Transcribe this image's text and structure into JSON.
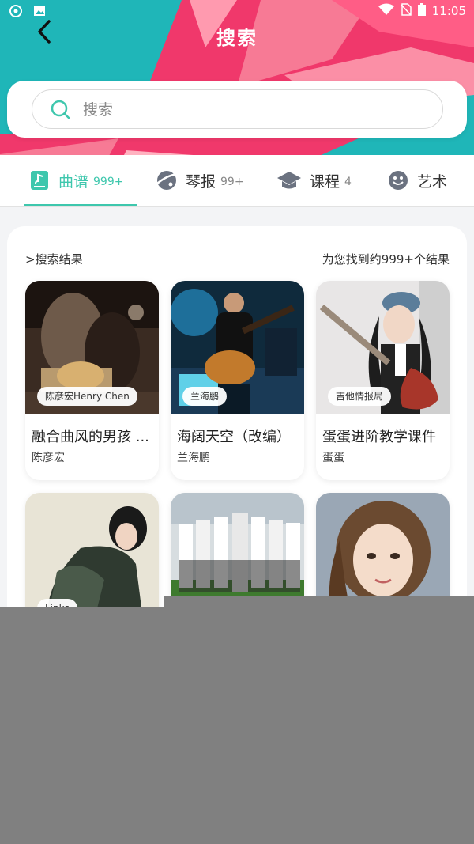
{
  "status_bar": {
    "time": "11:05"
  },
  "header": {
    "title": "搜索"
  },
  "search": {
    "placeholder": "搜索"
  },
  "tabs": [
    {
      "label": "曲谱",
      "count": "999+",
      "icon": "score-icon",
      "active": true
    },
    {
      "label": "琴报",
      "count": "99+",
      "icon": "planet-icon",
      "active": false
    },
    {
      "label": "课程",
      "count": "4",
      "icon": "graduation-cap-icon",
      "active": false
    },
    {
      "label": "艺术",
      "count": "",
      "icon": "smile-icon",
      "active": false
    }
  ],
  "results": {
    "heading": ">搜索结果",
    "summary": "为您找到约999+个结果",
    "items": [
      {
        "tag": "陈彦宏Henry Chen",
        "title": "融合曲风的男孩 ...",
        "author": "陈彦宏"
      },
      {
        "tag": "兰海鹏",
        "title": "海阔天空（改编）",
        "author": "兰海鹏"
      },
      {
        "tag": "吉他情报局",
        "title": "蛋蛋进阶教学课件",
        "author": "蛋蛋"
      },
      {
        "tag": "Links",
        "title": "",
        "author": ""
      },
      {
        "tag": "",
        "title": "",
        "author": ""
      },
      {
        "tag": "",
        "title": "",
        "author": ""
      }
    ]
  },
  "colors": {
    "accent": "#3ec7ad",
    "hero_teal": "#1fb6b8",
    "hero_pink": "#f0386b",
    "overlay": "#808080"
  }
}
